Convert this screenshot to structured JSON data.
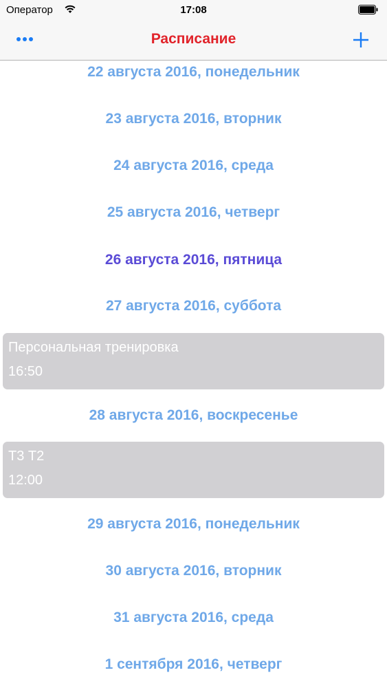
{
  "status_bar": {
    "carrier": "Оператор",
    "time": "17:08",
    "icons": [
      "wifi-icon",
      "battery-icon"
    ]
  },
  "nav": {
    "title": "Расписание",
    "left_icon": "more-icon",
    "right_icon": "plus-icon"
  },
  "colors": {
    "title": "#e1232a",
    "date": "#6fa8e8",
    "date_current": "#5a4bd6",
    "accent": "#1a7cf5",
    "card": "#d1d0d3"
  },
  "schedule": {
    "days": [
      {
        "label": "22 августа 2016, понедельник"
      },
      {
        "label": "23 августа 2016, вторник"
      },
      {
        "label": "24 августа 2016, среда"
      },
      {
        "label": "25 августа 2016, четверг"
      },
      {
        "label": "26 августа 2016, пятница",
        "current": true
      },
      {
        "label": "27 августа 2016, суббота"
      },
      {
        "label": "28 августа 2016, воскресенье"
      },
      {
        "label": "29 августа 2016, понедельник"
      },
      {
        "label": "30 августа 2016, вторник"
      },
      {
        "label": "31 августа 2016, среда"
      },
      {
        "label": "1 сентября 2016, четверг"
      }
    ],
    "events": [
      {
        "title": "Персональная тренировка",
        "time": "16:50"
      },
      {
        "title": "Т3 Т2",
        "time": "12:00"
      }
    ]
  }
}
